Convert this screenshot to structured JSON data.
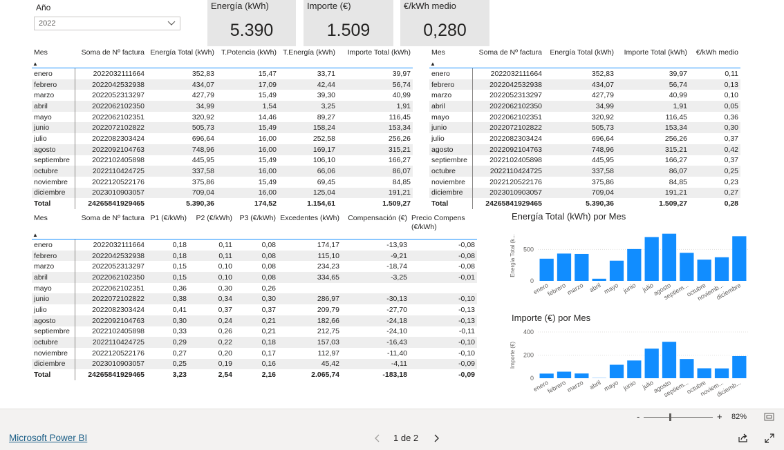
{
  "slicer": {
    "title": "Año",
    "value": "2022"
  },
  "cards": [
    {
      "label": "Energía (kWh)",
      "value": "5.390"
    },
    {
      "label": "Importe (€)",
      "value": "1.509"
    },
    {
      "label": "€/kWh medio",
      "value": "0,280"
    }
  ],
  "table1": {
    "headers": [
      "Mes",
      "Soma de Nº factura",
      "Energía Total (kWh)",
      "T.Potencia (kWh)",
      "T.Energía (kWh)",
      "Importe Total (kWh)"
    ],
    "rows": [
      [
        "enero",
        "2022032111664",
        "352,83",
        "15,47",
        "33,71",
        "39,97"
      ],
      [
        "febrero",
        "2022042532938",
        "434,07",
        "17,09",
        "42,44",
        "56,74"
      ],
      [
        "marzo",
        "2022052313297",
        "427,79",
        "15,49",
        "39,30",
        "40,99"
      ],
      [
        "abril",
        "2022062102350",
        "34,99",
        "1,54",
        "3,25",
        "1,91"
      ],
      [
        "mayo",
        "2022062102351",
        "320,92",
        "14,46",
        "89,27",
        "116,45"
      ],
      [
        "junio",
        "2022072102822",
        "505,73",
        "15,49",
        "158,24",
        "153,34"
      ],
      [
        "julio",
        "2022082303424",
        "696,64",
        "16,00",
        "252,58",
        "256,26"
      ],
      [
        "agosto",
        "2022092104763",
        "748,96",
        "16,00",
        "169,17",
        "315,21"
      ],
      [
        "septiembre",
        "2022102405898",
        "445,95",
        "15,49",
        "106,10",
        "166,27"
      ],
      [
        "octubre",
        "2022110424725",
        "337,58",
        "16,00",
        "66,06",
        "86,07"
      ],
      [
        "noviembre",
        "2022120522176",
        "375,86",
        "15,49",
        "69,45",
        "84,85"
      ],
      [
        "diciembre",
        "2023010903057",
        "709,04",
        "16,00",
        "125,04",
        "191,21"
      ]
    ],
    "total": [
      "Total",
      "24265841929465",
      "5.390,36",
      "174,52",
      "1.154,61",
      "1.509,27"
    ]
  },
  "table2": {
    "headers": [
      "Mes",
      "Soma de Nº factura",
      "Energía Total (kWh)",
      "Importe Total (kWh)",
      "€/kWh medio"
    ],
    "rows": [
      [
        "enero",
        "2022032111664",
        "352,83",
        "39,97",
        "0,11"
      ],
      [
        "febrero",
        "2022042532938",
        "434,07",
        "56,74",
        "0,13"
      ],
      [
        "marzo",
        "2022052313297",
        "427,79",
        "40,99",
        "0,10"
      ],
      [
        "abril",
        "2022062102350",
        "34,99",
        "1,91",
        "0,05"
      ],
      [
        "mayo",
        "2022062102351",
        "320,92",
        "116,45",
        "0,36"
      ],
      [
        "junio",
        "2022072102822",
        "505,73",
        "153,34",
        "0,30"
      ],
      [
        "julio",
        "2022082303424",
        "696,64",
        "256,26",
        "0,37"
      ],
      [
        "agosto",
        "2022092104763",
        "748,96",
        "315,21",
        "0,42"
      ],
      [
        "septiembre",
        "2022102405898",
        "445,95",
        "166,27",
        "0,37"
      ],
      [
        "octubre",
        "2022110424725",
        "337,58",
        "86,07",
        "0,25"
      ],
      [
        "noviembre",
        "2022120522176",
        "375,86",
        "84,85",
        "0,23"
      ],
      [
        "diciembre",
        "2023010903057",
        "709,04",
        "191,21",
        "0,27"
      ]
    ],
    "total": [
      "Total",
      "24265841929465",
      "5.390,36",
      "1.509,27",
      "0,28"
    ]
  },
  "table3": {
    "headers": [
      "Mes",
      "Soma de Nº factura",
      "P1 (€/kWh)",
      "P2 (€/kWh)",
      "P3 (€/kWh)",
      "Excedentes (kWh)",
      "Compensación (€)",
      "Precio Compens (€/kWh)"
    ],
    "rows": [
      [
        "enero",
        "2022032111664",
        "0,18",
        "0,11",
        "0,08",
        "174,17",
        "-13,93",
        "-0,08"
      ],
      [
        "febrero",
        "2022042532938",
        "0,18",
        "0,11",
        "0,08",
        "115,10",
        "-9,21",
        "-0,08"
      ],
      [
        "marzo",
        "2022052313297",
        "0,15",
        "0,10",
        "0,08",
        "234,23",
        "-18,74",
        "-0,08"
      ],
      [
        "abril",
        "2022062102350",
        "0,15",
        "0,10",
        "0,08",
        "334,65",
        "-3,25",
        "-0,01"
      ],
      [
        "mayo",
        "2022062102351",
        "0,36",
        "0,30",
        "0,26",
        "",
        "",
        ""
      ],
      [
        "junio",
        "2022072102822",
        "0,38",
        "0,34",
        "0,30",
        "286,97",
        "-30,13",
        "-0,10"
      ],
      [
        "julio",
        "2022082303424",
        "0,41",
        "0,37",
        "0,37",
        "209,79",
        "-27,70",
        "-0,13"
      ],
      [
        "agosto",
        "2022092104763",
        "0,30",
        "0,24",
        "0,21",
        "182,66",
        "-24,18",
        "-0,13"
      ],
      [
        "septiembre",
        "2022102405898",
        "0,33",
        "0,26",
        "0,21",
        "212,75",
        "-24,10",
        "-0,11"
      ],
      [
        "octubre",
        "2022110424725",
        "0,29",
        "0,22",
        "0,18",
        "157,03",
        "-16,43",
        "-0,10"
      ],
      [
        "noviembre",
        "2022120522176",
        "0,27",
        "0,20",
        "0,17",
        "112,97",
        "-11,40",
        "-0,10"
      ],
      [
        "diciembre",
        "2023010903057",
        "0,25",
        "0,19",
        "0,16",
        "45,42",
        "-4,11",
        "-0,09"
      ]
    ],
    "total": [
      "Total",
      "24265841929465",
      "3,23",
      "2,54",
      "2,16",
      "2.065,74",
      "-183,18",
      "-0,09"
    ]
  },
  "chart_data": [
    {
      "type": "bar",
      "title": "Energía Total (kWh) por Mes",
      "ylabel": "Energía Total (k...",
      "yticks": [
        "0",
        "500"
      ],
      "ylim": [
        0,
        800
      ],
      "categories": [
        "enero",
        "febrero",
        "marzo",
        "abril",
        "mayo",
        "junio",
        "julio",
        "agosto",
        "septiem...",
        "octubre",
        "noviemb...",
        "diciembre"
      ],
      "values": [
        352.83,
        434.07,
        427.79,
        34.99,
        320.92,
        505.73,
        696.64,
        748.96,
        445.95,
        337.58,
        375.86,
        709.04
      ],
      "color": "#118dff"
    },
    {
      "type": "bar",
      "title": "Importe (€) por Mes",
      "ylabel": "Importe (€)",
      "yticks": [
        "0",
        "200",
        "400"
      ],
      "ylim": [
        0,
        400
      ],
      "categories": [
        "enero",
        "febrero",
        "marzo",
        "abril",
        "mayo",
        "junio",
        "julio",
        "agosto",
        "septiem...",
        "octubre",
        "noviem...",
        "diciemb..."
      ],
      "values": [
        39.97,
        56.74,
        40.99,
        1.91,
        116.45,
        153.34,
        256.26,
        315.21,
        166.27,
        86.07,
        84.85,
        191.21
      ],
      "color": "#118dff"
    }
  ],
  "zoom": {
    "level": "82%",
    "minus": "-",
    "plus": "+"
  },
  "footer": {
    "brand": "Microsoft Power BI",
    "page": "1 de 2"
  }
}
